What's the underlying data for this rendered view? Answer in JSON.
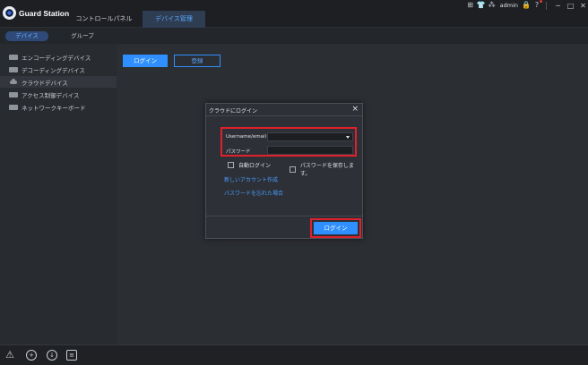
{
  "app": {
    "title": "Guard Station"
  },
  "tabs": [
    {
      "label": "コントロールパネル",
      "active": false
    },
    {
      "label": "デバイス管理",
      "active": true
    }
  ],
  "header_right": {
    "user": "admin"
  },
  "subtabs": [
    {
      "label": "デバイス",
      "active": true
    },
    {
      "label": "グループ",
      "active": false
    }
  ],
  "sidebar": {
    "items": [
      {
        "label": "エンコーディングデバイス",
        "icon": "encoder-icon",
        "active": false
      },
      {
        "label": "デコーディングデバイス",
        "icon": "decoder-icon",
        "active": false
      },
      {
        "label": "クラウドデバイス",
        "icon": "cloud-icon",
        "active": true
      },
      {
        "label": "アクセス制御デバイス",
        "icon": "access-control-icon",
        "active": false
      },
      {
        "label": "ネットワークキーボード",
        "icon": "keyboard-icon",
        "active": false
      }
    ]
  },
  "main": {
    "login_button": "ログイン",
    "register_button": "登録"
  },
  "dialog": {
    "title": "クラウドにログイン",
    "username_label": "Username/email",
    "username_value": "",
    "password_label": "パスワード",
    "password_value": "",
    "auto_login_label": "自動ログイン",
    "auto_login_checked": false,
    "save_password_label": "パスワードを保存します。",
    "save_password_checked": false,
    "new_account_link": "新しいアカウント作成",
    "forgot_password_link": "パスワードを忘れた場合",
    "login_button": "ログイン"
  },
  "colors": {
    "accent": "#2f8fff",
    "highlight": "#e0212b",
    "background": "#2b2e33"
  }
}
